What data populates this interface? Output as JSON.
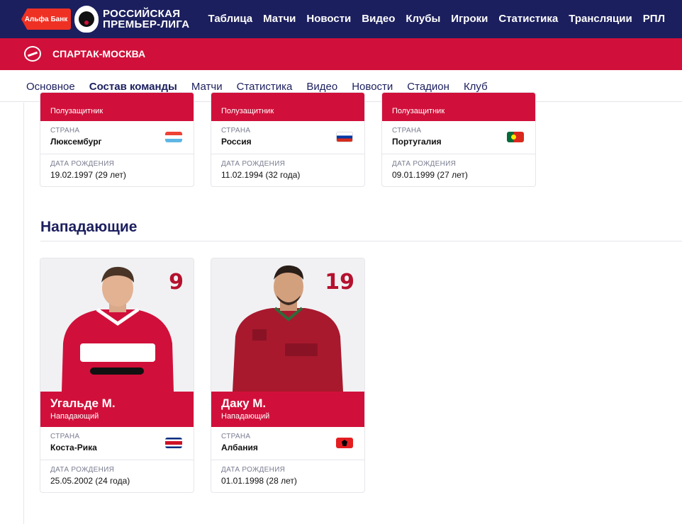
{
  "header": {
    "sponsor": "Альфа Банк",
    "league_line1": "РОССИЙСКАЯ",
    "league_line2": "ПРЕМЬЕР-ЛИГА",
    "nav": [
      "Таблица",
      "Матчи",
      "Новости",
      "Видео",
      "Клубы",
      "Игроки",
      "Статистика",
      "Трансляции",
      "РПЛ"
    ]
  },
  "club": {
    "name": "СПАРТАК-МОСКВА"
  },
  "tabs": [
    "Основное",
    "Состав команды",
    "Матчи",
    "Статистика",
    "Видео",
    "Новости",
    "Стадион",
    "Клуб"
  ],
  "active_tab": "Состав команды",
  "labels": {
    "country": "СТРАНА",
    "birth": "ДАТА РОЖДЕНИЯ"
  },
  "midfielders": [
    {
      "position": "Полузащитник",
      "country": "Люксембург",
      "flag": "luxembourg",
      "birth": "19.02.1997 (29 лет)"
    },
    {
      "position": "Полузащитник",
      "country": "Россия",
      "flag": "russia",
      "birth": "11.02.1994 (32 года)"
    },
    {
      "position": "Полузащитник",
      "country": "Португалия",
      "flag": "portugal",
      "birth": "09.01.1999 (27 лет)"
    }
  ],
  "forwards_title": "Нападающие",
  "forwards": [
    {
      "number": "9",
      "name": "Угальде М.",
      "position": "Нападающий",
      "country": "Коста-Рика",
      "flag": "costa-rica",
      "birth": "25.05.2002 (24 года)",
      "kit": "red-white"
    },
    {
      "number": "19",
      "name": "Даку М.",
      "position": "Нападающий",
      "country": "Албания",
      "flag": "albania",
      "birth": "01.01.1998 (28 лет)",
      "kit": "maroon"
    }
  ],
  "colors": {
    "navy": "#1c1f5e",
    "red": "#d0103a",
    "number_red": "#b5112e"
  }
}
